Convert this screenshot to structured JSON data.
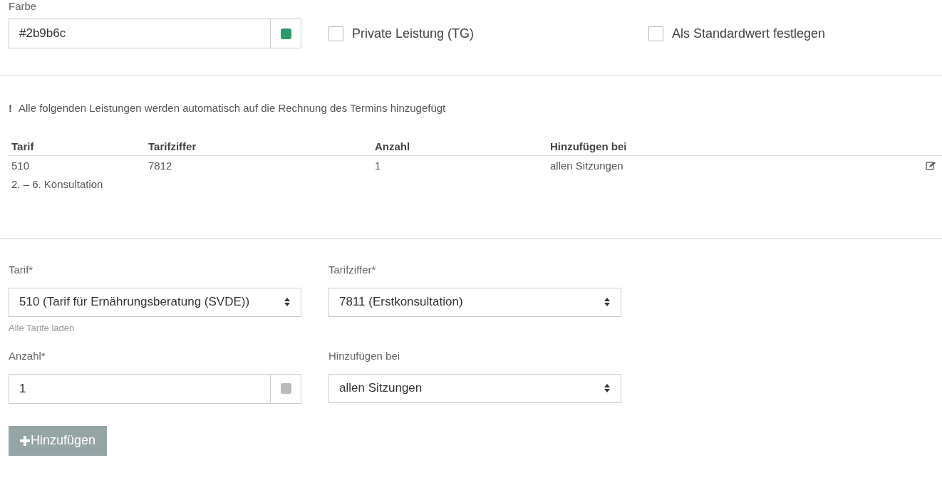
{
  "color_field": {
    "label": "Farbe",
    "value": "#2b9b6c",
    "color": "#2b9b6c"
  },
  "checkboxes": [
    {
      "label": "Private Leistung (TG)",
      "checked": false
    },
    {
      "label": "Als Standardwert festlegen",
      "checked": false
    }
  ],
  "notice": {
    "icon": "!",
    "text": "Alle folgenden Leistungen werden automatisch auf die Rechnung des Termins hinzugefügt"
  },
  "table": {
    "columns": [
      "Tarif",
      "Tarifziffer",
      "Anzahl",
      "Hinzufügen bei"
    ],
    "rows": [
      {
        "cells": [
          "510",
          "7812",
          "1",
          "allen Sitzungen"
        ],
        "description": "2. – 6. Konsultation"
      }
    ]
  },
  "form": {
    "fields": [
      {
        "kind": "select",
        "label": "Tarif*",
        "value": "510 (Tarif für Ernährungsberatung (SVDE))",
        "hint": "Alle Tarife laden"
      },
      {
        "kind": "select",
        "label": "Tarifziffer*",
        "value": "7811 (Erstkonsultation)"
      },
      {
        "kind": "input",
        "label": "Anzahl*",
        "value": "1"
      },
      {
        "kind": "select",
        "label": "Hinzufügen bei",
        "value": "allen Sitzungen"
      }
    ],
    "button": "Hinzufügen"
  }
}
